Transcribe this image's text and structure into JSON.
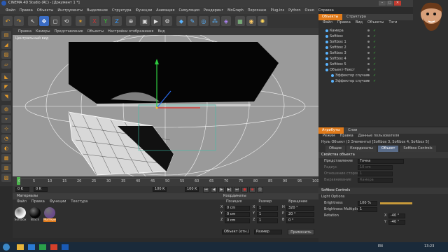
{
  "window": {
    "title": "CINEMA 4D Studio (RC) - [Документ 1 *]",
    "min": "–",
    "max": "□",
    "close": "✕"
  },
  "menu": [
    "Файл",
    "Правка",
    "Объекты",
    "Инструменты",
    "Выделение",
    "Структура",
    "Функции",
    "Анимация",
    "Симуляция",
    "Рендеринг",
    "MoGraph",
    "Персонаж",
    "Plug-ins",
    "Python",
    "Окно",
    "Справка"
  ],
  "viewport": {
    "menu": [
      "Правка",
      "Камеры",
      "Представление",
      "Объекты",
      "Настройки отображения",
      "Вид"
    ],
    "label": "Центральный вид"
  },
  "timeline": {
    "ticks": [
      "0",
      "5",
      "10",
      "15",
      "20",
      "25",
      "30",
      "35",
      "40",
      "45",
      "50",
      "55",
      "60",
      "65",
      "70",
      "75",
      "80",
      "85",
      "90",
      "95",
      "100"
    ],
    "start": "0 K",
    "cur": "0 K",
    "end": "100 K",
    "end2": "100 K",
    "frame": "0 K"
  },
  "materials": {
    "header": "Материалы",
    "menu": [
      "Файл",
      "Правка",
      "Функции",
      "Текстура"
    ],
    "items": [
      {
        "name": "Softbox",
        "color": "#f2f2f2"
      },
      {
        "name": "Black",
        "color": "#050505"
      },
      {
        "name": "Матери",
        "color": "#6a4a8a"
      }
    ]
  },
  "coords": {
    "header": "Координаты",
    "cols": [
      "Позиция",
      "Размер",
      "Вращение"
    ],
    "rows": [
      {
        "axis": "X",
        "pos": "0 cm",
        "sa": "X",
        "size": "1",
        "ra": "H",
        "rot": "320 °"
      },
      {
        "axis": "Y",
        "pos": "0 cm",
        "sa": "Y",
        "size": "1",
        "ra": "P",
        "rot": "20 °"
      },
      {
        "axis": "Z",
        "pos": "0 cm",
        "sa": "Z",
        "size": "1",
        "ra": "B",
        "rot": "0 °"
      }
    ],
    "mode1": "Объект (отн.)",
    "mode2": "Размер",
    "apply": "Применить"
  },
  "objects": {
    "tabs": [
      "Объекты",
      "Структура"
    ],
    "menu": [
      "Файл",
      "Правка",
      "Вид",
      "Объекты",
      "Тэги"
    ],
    "items": [
      {
        "name": "Камера",
        "indent": 0
      },
      {
        "name": "Softbox",
        "indent": 0
      },
      {
        "name": "Softbox 1",
        "indent": 0
      },
      {
        "name": "Softbox 2",
        "indent": 0
      },
      {
        "name": "Softbox 3",
        "indent": 0
      },
      {
        "name": "Softbox 4",
        "indent": 0
      },
      {
        "name": "Softbox 5",
        "indent": 0
      },
      {
        "name": "Объект-Текст",
        "indent": 0
      },
      {
        "name": "Эффектор случая",
        "indent": 1
      },
      {
        "name": "Эффектор случая",
        "indent": 1
      }
    ]
  },
  "attributes": {
    "tabs": [
      "Атрибуты",
      "Слои"
    ],
    "menu": [
      "Режим",
      "Правка",
      "Данные пользователя"
    ],
    "info": "Нуль Объект (3 Элементы) [Softbox 3, Softbox 4, Softbox 5]",
    "subtabs": [
      "Общие",
      "Координаты",
      "Объект",
      "Softbox Controls"
    ],
    "section1": "Свойства объекта",
    "props": [
      {
        "label": "Представление",
        "value": "Точка"
      },
      {
        "label": "Радиус",
        "value": "10 cm"
      },
      {
        "label": "Отношение сторон",
        "value": "1"
      },
      {
        "label": "Выравнивание",
        "value": "Камера"
      }
    ],
    "section2": "Softbox Controls",
    "sub": "Light Options",
    "brightness": {
      "label": "Brightness",
      "value": "100 %",
      "level": 1.0
    },
    "multiplier": {
      "label": "Brightness Multiplier",
      "value": "1"
    },
    "rotation": {
      "label": "Rotation",
      "x": "-40 °",
      "y": "-40 °",
      "xlabel": "X",
      "ylabel": "Y"
    }
  },
  "taskbar": {
    "lang": "EN",
    "time": "13:23",
    "accent": "#1a2a3a"
  }
}
